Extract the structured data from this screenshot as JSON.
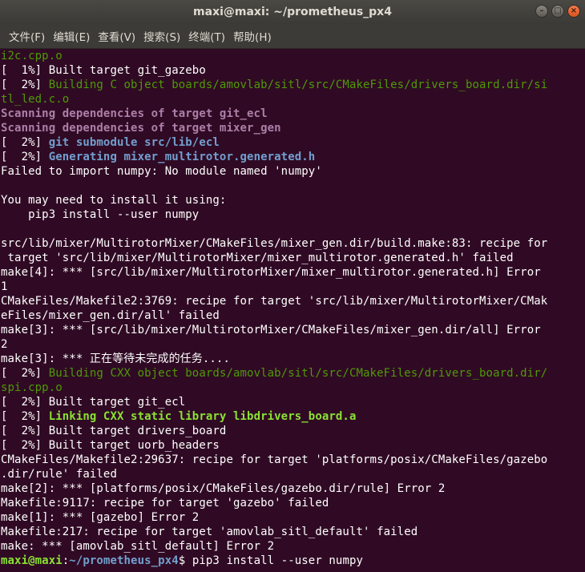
{
  "window": {
    "title": "maxi@maxi: ~/prometheus_px4",
    "controls": {
      "minimize": "–",
      "maximize": "□",
      "close": "×"
    }
  },
  "menubar": [
    "文件(F)",
    "编辑(E)",
    "查看(V)",
    "搜索(S)",
    "终端(T)",
    "帮助(H)"
  ],
  "colors": {
    "background": "#300a24",
    "green": "#4e9a06",
    "bright_green": "#8ae234",
    "magenta": "#ad7fa8",
    "blue": "#729fcf"
  },
  "terminal": {
    "lines": [
      [
        {
          "t": "i2c.cpp.o",
          "c": "green"
        }
      ],
      [
        {
          "t": "[  1%] Built target git_gazebo",
          "c": "default"
        }
      ],
      [
        {
          "t": "[  2%] ",
          "c": "default"
        },
        {
          "t": "Building C object boards/amovlab/sitl/src/CMakeFiles/drivers_board.dir/si",
          "c": "green"
        }
      ],
      [
        {
          "t": "tl_led.c.o",
          "c": "green"
        }
      ],
      [
        {
          "t": "Scanning dependencies of target git_ecl",
          "c": "magenta"
        }
      ],
      [
        {
          "t": "Scanning dependencies of target mixer_gen",
          "c": "magenta"
        }
      ],
      [
        {
          "t": "[  2%] ",
          "c": "default"
        },
        {
          "t": "git submodule src/lib/ecl",
          "c": "blue"
        }
      ],
      [
        {
          "t": "[  2%] ",
          "c": "default"
        },
        {
          "t": "Generating mixer_multirotor.generated.h",
          "c": "blue"
        }
      ],
      [
        {
          "t": "Failed to import numpy: No module named 'numpy'",
          "c": "default"
        }
      ],
      [
        {
          "t": "",
          "c": "default"
        }
      ],
      [
        {
          "t": "You may need to install it using:",
          "c": "default"
        }
      ],
      [
        {
          "t": "    pip3 install --user numpy",
          "c": "default"
        }
      ],
      [
        {
          "t": "",
          "c": "default"
        }
      ],
      [
        {
          "t": "src/lib/mixer/MultirotorMixer/CMakeFiles/mixer_gen.dir/build.make:83: recipe for",
          "c": "default"
        }
      ],
      [
        {
          "t": " target 'src/lib/mixer/MultirotorMixer/mixer_multirotor.generated.h' failed",
          "c": "default"
        }
      ],
      [
        {
          "t": "make[4]: *** [src/lib/mixer/MultirotorMixer/mixer_multirotor.generated.h] Error",
          "c": "default"
        }
      ],
      [
        {
          "t": "1",
          "c": "default"
        }
      ],
      [
        {
          "t": "CMakeFiles/Makefile2:3769: recipe for target 'src/lib/mixer/MultirotorMixer/CMak",
          "c": "default"
        }
      ],
      [
        {
          "t": "eFiles/mixer_gen.dir/all' failed",
          "c": "default"
        }
      ],
      [
        {
          "t": "make[3]: *** [src/lib/mixer/MultirotorMixer/CMakeFiles/mixer_gen.dir/all] Error",
          "c": "default"
        }
      ],
      [
        {
          "t": "2",
          "c": "default"
        }
      ],
      [
        {
          "t": "make[3]: *** 正在等待未完成的任务....",
          "c": "default"
        }
      ],
      [
        {
          "t": "[  2%] ",
          "c": "default"
        },
        {
          "t": "Building CXX object boards/amovlab/sitl/src/CMakeFiles/drivers_board.dir/",
          "c": "green"
        }
      ],
      [
        {
          "t": "spi.cpp.o",
          "c": "green"
        }
      ],
      [
        {
          "t": "[  2%] Built target git_ecl",
          "c": "default"
        }
      ],
      [
        {
          "t": "[  2%] ",
          "c": "default"
        },
        {
          "t": "Linking CXX static library libdrivers_board.a",
          "c": "bgreen"
        }
      ],
      [
        {
          "t": "[  2%] Built target drivers_board",
          "c": "default"
        }
      ],
      [
        {
          "t": "[  2%] Built target uorb_headers",
          "c": "default"
        }
      ],
      [
        {
          "t": "CMakeFiles/Makefile2:29637: recipe for target 'platforms/posix/CMakeFiles/gazebo",
          "c": "default"
        }
      ],
      [
        {
          "t": ".dir/rule' failed",
          "c": "default"
        }
      ],
      [
        {
          "t": "make[2]: *** [platforms/posix/CMakeFiles/gazebo.dir/rule] Error 2",
          "c": "default"
        }
      ],
      [
        {
          "t": "Makefile:9117: recipe for target 'gazebo' failed",
          "c": "default"
        }
      ],
      [
        {
          "t": "make[1]: *** [gazebo] Error 2",
          "c": "default"
        }
      ],
      [
        {
          "t": "Makefile:217: recipe for target 'amovlab_sitl_default' failed",
          "c": "default"
        }
      ],
      [
        {
          "t": "make: *** [amovlab_sitl_default] Error 2",
          "c": "default"
        }
      ],
      [
        {
          "t": "maxi@maxi",
          "c": "pgreen"
        },
        {
          "t": ":",
          "c": "default"
        },
        {
          "t": "~/prometheus_px4",
          "c": "pblue"
        },
        {
          "t": "$ pip3 install --user numpy",
          "c": "default"
        }
      ]
    ]
  }
}
